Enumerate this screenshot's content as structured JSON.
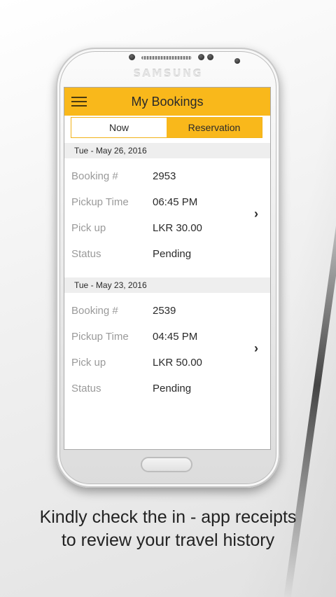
{
  "device": {
    "brand": "SAMSUNG"
  },
  "app": {
    "title": "My Bookings",
    "menu_icon": "hamburger-menu-icon",
    "colors": {
      "accent": "#f9b81b",
      "date_row_bg": "#eeeeee",
      "label_gray": "#9a9a9a"
    },
    "tabs": [
      {
        "label": "Now",
        "active": false
      },
      {
        "label": "Reservation",
        "active": true
      }
    ],
    "bookings": [
      {
        "date": "Tue -  May 26, 2016",
        "fields": [
          {
            "label": "Booking #",
            "value": "2953"
          },
          {
            "label": "Pickup Time",
            "value": "06:45 PM"
          },
          {
            "label": "Pick up",
            "value": "LKR 30.00"
          },
          {
            "label": "Status",
            "value": "Pending"
          }
        ],
        "chevron": "›"
      },
      {
        "date": "Tue -  May 23, 2016",
        "fields": [
          {
            "label": "Booking #",
            "value": "2539"
          },
          {
            "label": "Pickup Time",
            "value": "04:45 PM"
          },
          {
            "label": "Pick up",
            "value": "LKR 50.00"
          },
          {
            "label": "Status",
            "value": "Pending"
          }
        ],
        "chevron": "›"
      }
    ]
  },
  "caption": {
    "line1": "Kindly check the in - app receipts",
    "line2": "to review your travel history"
  }
}
